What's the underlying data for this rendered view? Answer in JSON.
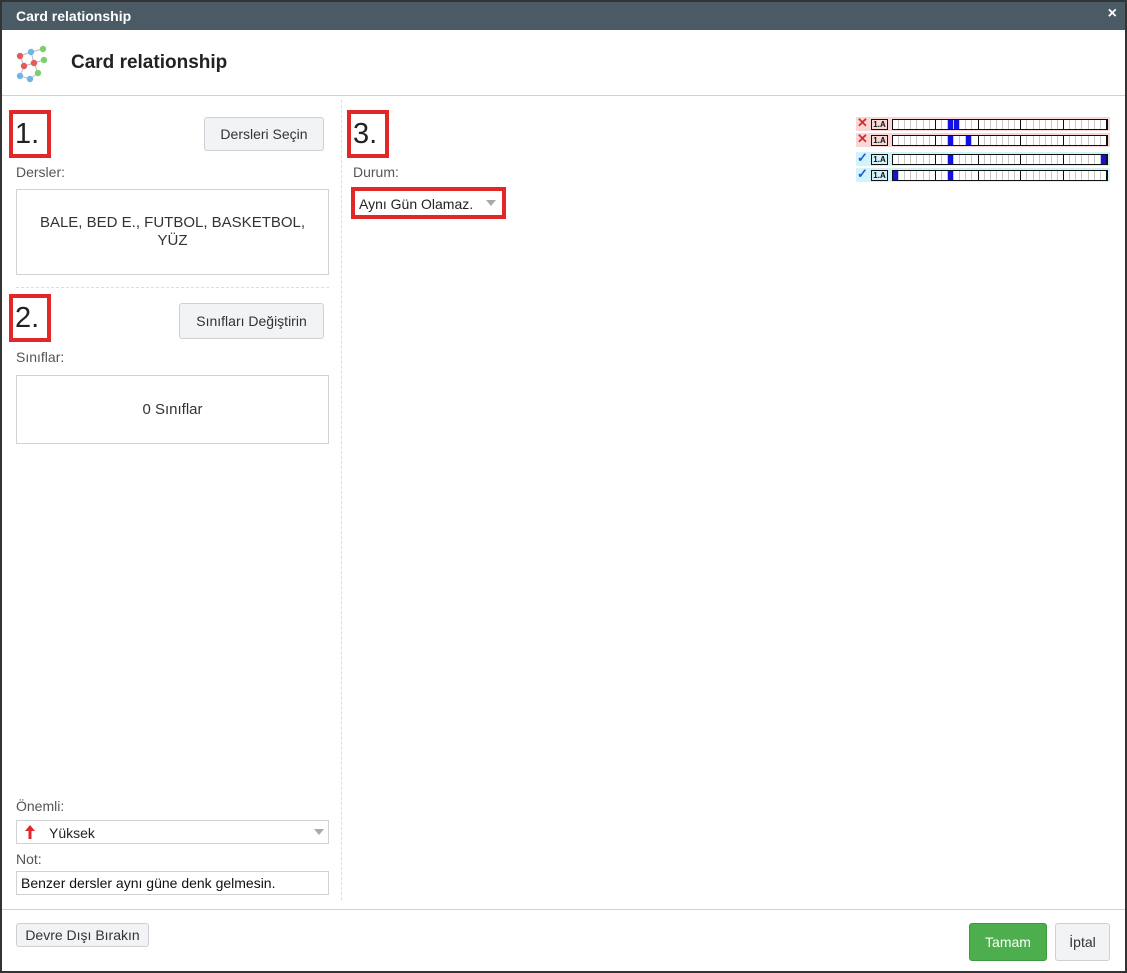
{
  "window": {
    "title": "Card relationship",
    "close_icon": "×"
  },
  "header": {
    "title": "Card relationship",
    "logo": "network-graph-icon"
  },
  "step1": {
    "number": "1.",
    "button_label": "Dersleri Seçin",
    "field_label": "Dersler:",
    "value": "BALE, BED E., FUTBOL, BASKETBOL, YÜZ"
  },
  "step2": {
    "number": "2.",
    "button_label": "Sınıfları Değiştirin",
    "field_label": "Sınıflar:",
    "value": "0 Sınıflar"
  },
  "step3": {
    "number": "3.",
    "field_label": "Durum:",
    "selected": "Aynı Gün Olamaz."
  },
  "importance": {
    "label": "Önemli:",
    "selected": "Yüksek",
    "icon": "red-up-arrow-icon"
  },
  "note": {
    "label": "Not:",
    "value": "Benzer dersler aynı güne denk gelmesin."
  },
  "legend": {
    "tag_text": "1.A",
    "rows": [
      {
        "status": "invalid",
        "mark": "✕",
        "filled": [
          9,
          10
        ]
      },
      {
        "status": "invalid",
        "mark": "✕",
        "filled": [
          9,
          12
        ]
      },
      {
        "status": "valid",
        "mark": "✓",
        "filled": [
          9,
          34
        ]
      },
      {
        "status": "valid",
        "mark": "✓",
        "filled": [
          0,
          9
        ]
      }
    ],
    "colors": {
      "invalid_bg": "#f9d7d7",
      "valid_bg": "#d2f3fa",
      "filled": "#1212e0",
      "invalid_mark": "#e32727",
      "valid_mark": "#1a5fd6"
    }
  },
  "footer": {
    "disable_button": "Devre Dışı Bırakın",
    "ok_button": "Tamam",
    "cancel_button": "İptal"
  },
  "colors": {
    "accent_red": "#e32727",
    "ok_green": "#4cae4c",
    "titlebar": "#4b5b66"
  }
}
